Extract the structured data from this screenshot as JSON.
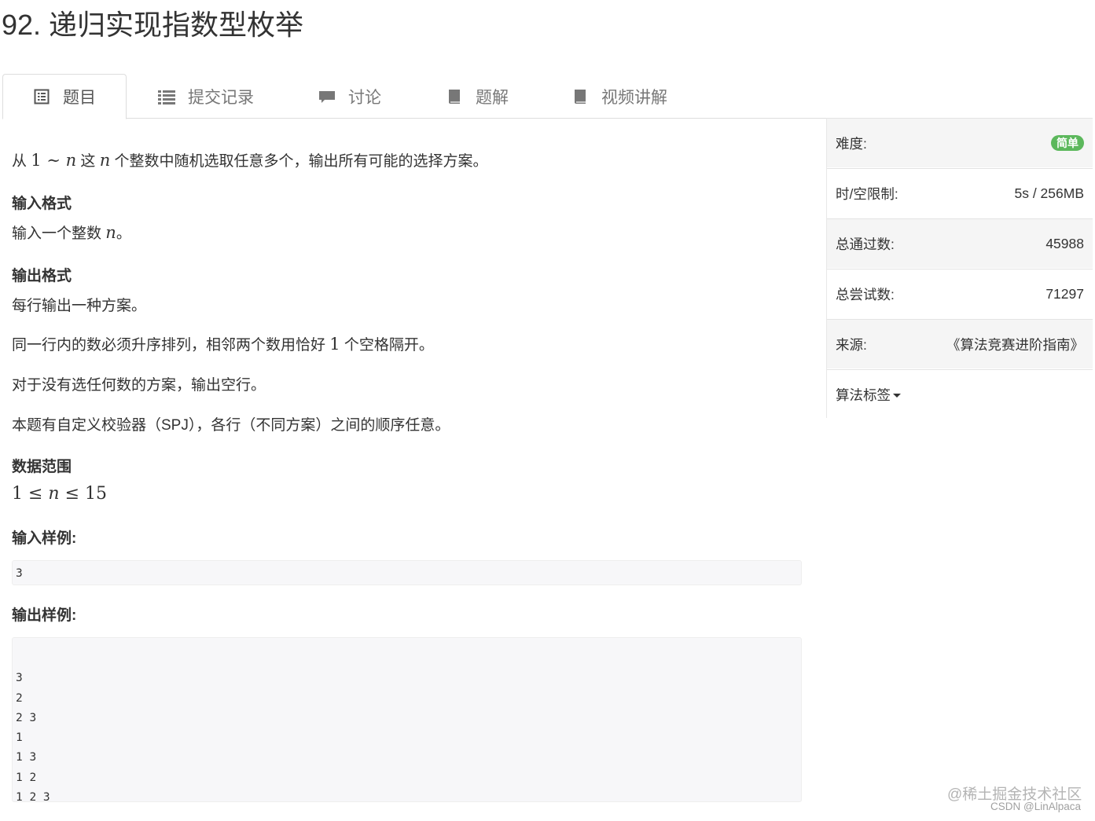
{
  "title": "92. 递归实现指数型枚举",
  "tabs": [
    {
      "label": "题目",
      "icon": "list-alt-icon"
    },
    {
      "label": "提交记录",
      "icon": "list-icon"
    },
    {
      "label": "讨论",
      "icon": "comment-icon"
    },
    {
      "label": "题解",
      "icon": "book-icon"
    },
    {
      "label": "视频讲解",
      "icon": "book-icon"
    }
  ],
  "problem": {
    "intro": {
      "p1": "从 ",
      "m1": "1",
      "m2": " ∼ ",
      "m3": "n",
      "p2": " 这 ",
      "m4": "n",
      "p3": " 个整数中随机选取任意多个，输出所有可能的选择方案。"
    },
    "input_heading": "输入格式",
    "input_desc": {
      "p1": "输入一个整数 ",
      "m1": "n",
      "p2": "。"
    },
    "output_heading": "输出格式",
    "output_desc1": "每行输出一种方案。",
    "output_desc2": {
      "p1": "同一行内的数必须升序排列，相邻两个数用恰好 ",
      "m1": "1",
      "p2": " 个空格隔开。"
    },
    "output_desc3": "对于没有选任何数的方案，输出空行。",
    "output_desc4": "本题有自定义校验器（SPJ），各行（不同方案）之间的顺序任意。",
    "range_heading": "数据范围",
    "range": {
      "a": "1",
      "le1": " ≤ ",
      "n": "n",
      "le2": " ≤ ",
      "b": "15"
    },
    "sample_input_heading": "输入样例:",
    "sample_input": "3",
    "sample_output_heading": "输出样例:",
    "sample_output": "\n3\n2\n2 3\n1\n1 3\n1 2\n1 2 3"
  },
  "sidebar": {
    "difficulty_label": "难度:",
    "difficulty_value": "简单",
    "limit_label": "时/空限制:",
    "limit_value": "5s / 256MB",
    "passed_label": "总通过数:",
    "passed_value": "45988",
    "attempts_label": "总尝试数:",
    "attempts_value": "71297",
    "source_label": "来源:",
    "source_value": "《算法竞赛进阶指南》",
    "tags_label": "算法标签"
  },
  "watermark": {
    "line1": "@稀土掘金技术社区",
    "line2": "CSDN @LinAlpaca"
  },
  "colors": {
    "badge": "#5cb85c",
    "tab_text": "#777777",
    "code_bg": "#f7f7f9"
  }
}
